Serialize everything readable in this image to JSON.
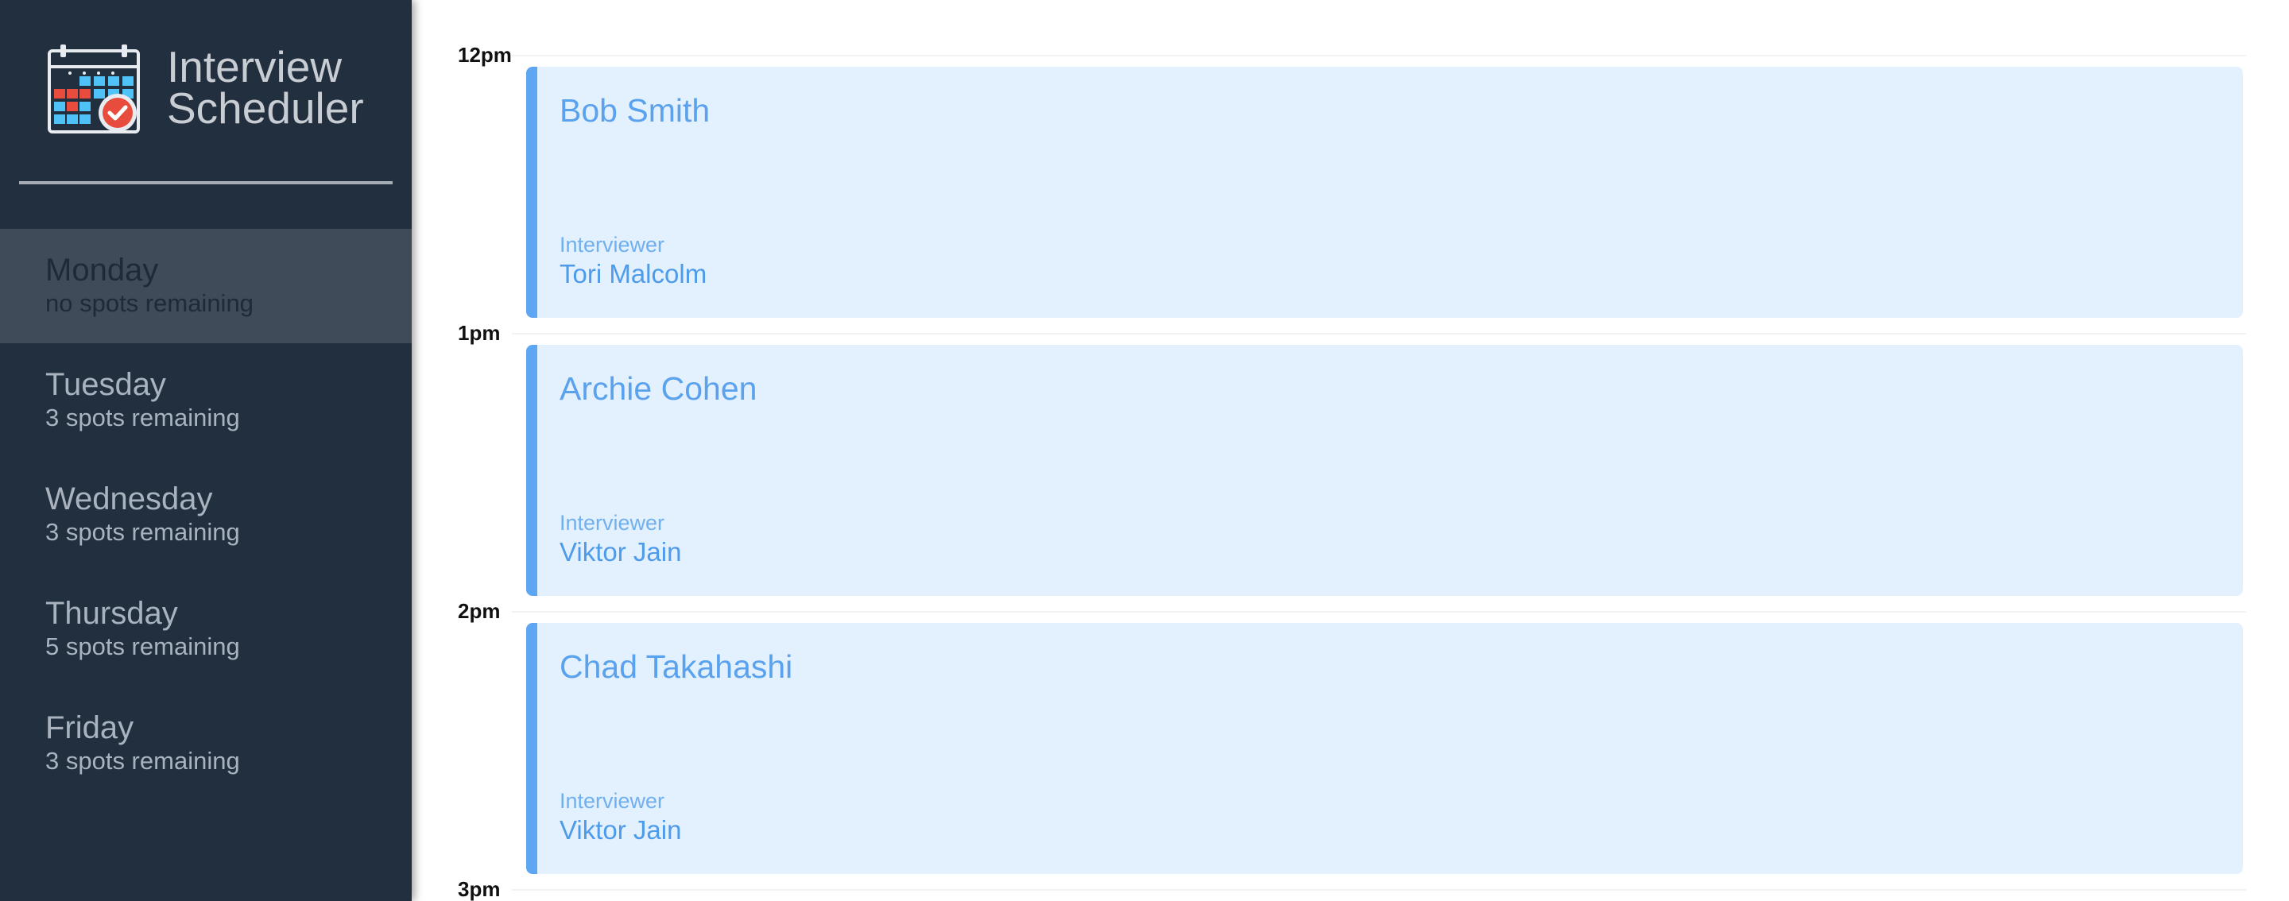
{
  "app": {
    "title_line1": "Interview",
    "title_line2": "Scheduler"
  },
  "colors": {
    "sidebar_bg": "#222f3e",
    "selected_day_bg": "#3f4b59",
    "appointment_bg": "#e3f0fd",
    "appointment_accent": "#5ea6f2"
  },
  "days": [
    {
      "name": "Monday",
      "spots": "no spots remaining",
      "selected": true
    },
    {
      "name": "Tuesday",
      "spots": "3 spots remaining",
      "selected": false
    },
    {
      "name": "Wednesday",
      "spots": "3 spots remaining",
      "selected": false
    },
    {
      "name": "Thursday",
      "spots": "5 spots remaining",
      "selected": false
    },
    {
      "name": "Friday",
      "spots": "3 spots remaining",
      "selected": false
    }
  ],
  "hours": [
    "12pm",
    "1pm",
    "2pm",
    "3pm"
  ],
  "appointments": [
    {
      "student": "Bob Smith",
      "interviewer_label": "Interviewer",
      "interviewer": "Tori Malcolm"
    },
    {
      "student": "Archie Cohen",
      "interviewer_label": "Interviewer",
      "interviewer": "Viktor Jain"
    },
    {
      "student": "Chad Takahashi",
      "interviewer_label": "Interviewer",
      "interviewer": "Viktor Jain"
    }
  ]
}
